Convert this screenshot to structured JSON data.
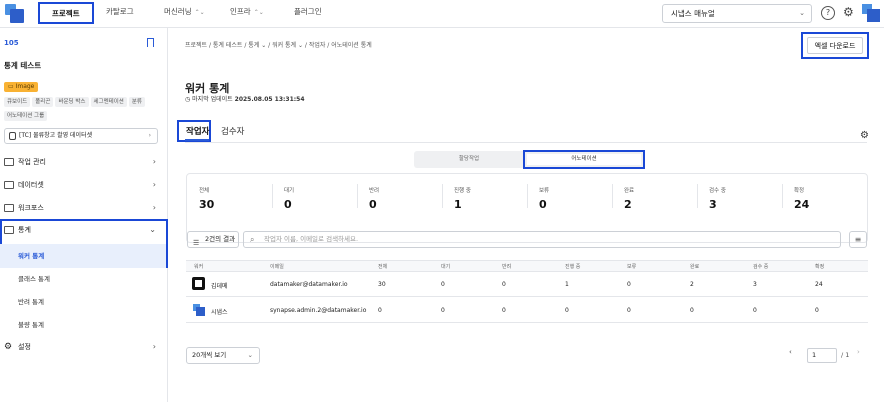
{
  "topnav": {
    "items": [
      {
        "label": "프로젝트",
        "has_dropdown": false,
        "active": true
      },
      {
        "label": "카탈로그",
        "has_dropdown": false,
        "active": false
      },
      {
        "label": "머신러닝",
        "has_dropdown": true,
        "active": false
      },
      {
        "label": "인프라",
        "has_dropdown": true,
        "active": false
      },
      {
        "label": "플러그인",
        "has_dropdown": false,
        "active": false
      }
    ],
    "manual_select": "시냅스 매뉴얼",
    "help_icon": "question-circle-icon",
    "settings_icon": "gear-icon"
  },
  "sidebar": {
    "project_id": "105",
    "project_name": "통계 테스트",
    "data_type_badge": "Image",
    "tags": [
      "큐보이드",
      "폴리곤",
      "바운딩 박스",
      "세그멘테이션",
      "분류",
      "어노테이션 그룹"
    ],
    "dataset": "[TC] 물류창고 촬영 데이터셋",
    "menu": [
      {
        "label": "작업 관리"
      },
      {
        "label": "데이터셋"
      },
      {
        "label": "워크포스"
      },
      {
        "label": "통계"
      }
    ],
    "stats_sub": [
      "워커 통계",
      "클래스 통계",
      "반려 통계",
      "불량 통계"
    ],
    "settings_label": "설정"
  },
  "main": {
    "breadcrumb": "프로젝트 / 통계 테스트 / 통계 ⌄ / 워커 통계 ⌄ / 작업자 / 어노테이션 통계",
    "excel_button": "엑셀 다운로드",
    "title": "워커 통계",
    "updated_label": "마지막 업데이트",
    "updated_value": "2025.08.05 13:31:54",
    "tabs": [
      "작업자",
      "검수자"
    ],
    "segments": [
      "할당작업",
      "어노테이션"
    ],
    "stats": [
      {
        "label": "전체",
        "value": "30"
      },
      {
        "label": "대기",
        "value": "0"
      },
      {
        "label": "반려",
        "value": "0"
      },
      {
        "label": "진행 중",
        "value": "1"
      },
      {
        "label": "보류",
        "value": "0"
      },
      {
        "label": "완료",
        "value": "2"
      },
      {
        "label": "검수 중",
        "value": "3"
      },
      {
        "label": "확정",
        "value": "24"
      }
    ],
    "filter_label": "2건의 결과",
    "search_placeholder": "작업자 이름, 이메일로 검색하세요.",
    "table": {
      "headers": [
        "워커",
        "이메일",
        "전체",
        "대기",
        "반려",
        "진행 중",
        "보류",
        "완료",
        "검수 중",
        "확정"
      ],
      "rows": [
        [
          "김데메",
          "datamaker@datamaker.io",
          "30",
          "0",
          "0",
          "1",
          "0",
          "2",
          "3",
          "24"
        ],
        [
          "시냅스",
          "synapse.admin.2@datamaker.io",
          "0",
          "0",
          "0",
          "0",
          "0",
          "0",
          "0",
          "0"
        ]
      ]
    },
    "page_size": "20개씩 보기",
    "page_current": "1",
    "page_total": "/ 1"
  }
}
